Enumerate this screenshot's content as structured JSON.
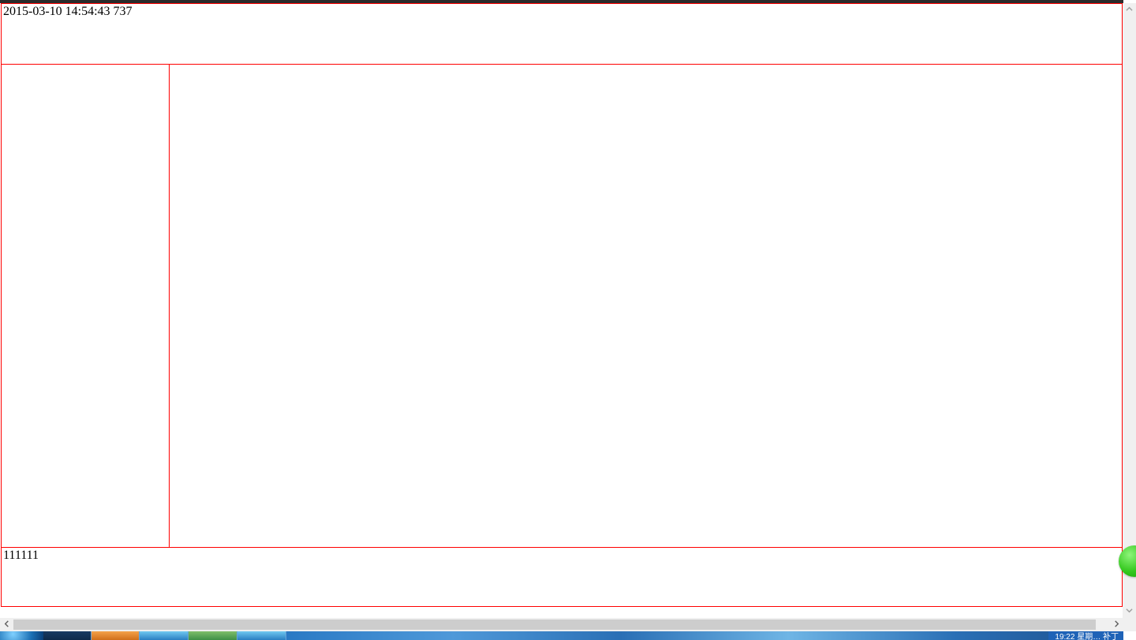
{
  "page": {
    "header_text": "2015-03-10 14:54:43 737",
    "footer_text": "111111"
  },
  "taskbar": {
    "clock": "19:22 星期… 补丁"
  },
  "colors": {
    "border": "#ff0000"
  }
}
